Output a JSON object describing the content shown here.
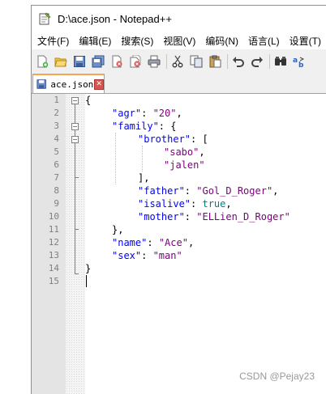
{
  "window": {
    "title": "D:\\ace.json - Notepad++"
  },
  "menu": [
    {
      "label": "文件(F)"
    },
    {
      "label": "编辑(E)"
    },
    {
      "label": "搜索(S)"
    },
    {
      "label": "视图(V)"
    },
    {
      "label": "编码(N)"
    },
    {
      "label": "语言(L)"
    },
    {
      "label": "设置(T)"
    }
  ],
  "toolbar": {
    "icons": [
      "new-file-icon",
      "open-file-icon",
      "save-icon",
      "save-all-icon",
      "close-icon",
      "close-all-icon",
      "print-icon",
      "cut-icon",
      "copy-icon",
      "paste-icon",
      "undo-icon",
      "redo-icon",
      "find-icon",
      "replace-icon"
    ]
  },
  "tab": {
    "label": "ace.json",
    "close_glyph": "✕"
  },
  "editor": {
    "line_numbers": [
      "1",
      "2",
      "3",
      "4",
      "5",
      "6",
      "7",
      "8",
      "9",
      "10",
      "11",
      "12",
      "13",
      "14",
      "15"
    ],
    "current_line": 15
  },
  "watermark": "CSDN @Pejay23",
  "colors": {
    "key": "#0000ff",
    "string": "#800080",
    "boolean": "#008080",
    "current_line_bg": "#e8e8ff",
    "tab_accent": "#f7a34f"
  }
}
